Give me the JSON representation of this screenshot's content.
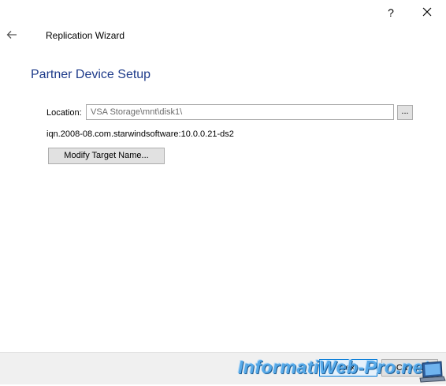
{
  "titlebar": {
    "help_label": "?",
    "close_icon": "close-icon"
  },
  "header": {
    "back_icon": "arrow-left-icon",
    "title": "Replication Wizard"
  },
  "page": {
    "heading": "Partner Device Setup"
  },
  "location": {
    "label": "Location:",
    "value": "VSA Storage\\mnt\\disk1\\",
    "browse_label": "..."
  },
  "target": {
    "iqn": "iqn.2008-08.com.starwindsoftware:10.0.0.21-ds2",
    "modify_label": "Modify Target Name..."
  },
  "footer": {
    "next_label": "Next",
    "cancel_label": "Cancel"
  },
  "watermark": {
    "text": "InformatiWeb-Pro.net"
  },
  "colors": {
    "heading": "#1e3b8a",
    "accent_border": "#0078d7",
    "footer_bg": "#f0f0f0"
  }
}
